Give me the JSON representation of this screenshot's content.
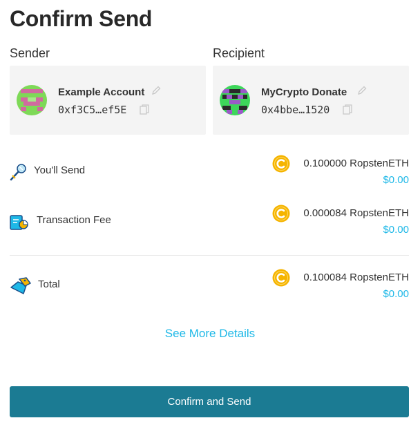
{
  "page": {
    "title": "Confirm Send"
  },
  "sender": {
    "label": "Sender",
    "account_name": "Example Account",
    "address": "0xf3C5…ef5E",
    "avatar_icon": "identicon-green-pink"
  },
  "recipient": {
    "label": "Recipient",
    "account_name": "MyCrypto Donate",
    "address": "0x4bbe…1520",
    "avatar_icon": "identicon-green-purple-black"
  },
  "rows": {
    "send": {
      "label": "You'll Send",
      "icon": "wand-icon",
      "amount": "0.100000 RopstenETH",
      "fiat": "$0.00"
    },
    "fee": {
      "label": "Transaction Fee",
      "icon": "fee-chart-icon",
      "amount": "0.000084 RopstenETH",
      "fiat": "$0.00"
    },
    "total": {
      "label": "Total",
      "icon": "tag-icon",
      "amount": "0.100084 RopstenETH",
      "fiat": "$0.00"
    }
  },
  "actions": {
    "see_more": "See More Details",
    "confirm": "Confirm and Send"
  },
  "colors": {
    "link": "#1eb8e7",
    "button": "#1b7b93",
    "card_bg": "#f4f4f4",
    "coin": "#f5b400"
  }
}
